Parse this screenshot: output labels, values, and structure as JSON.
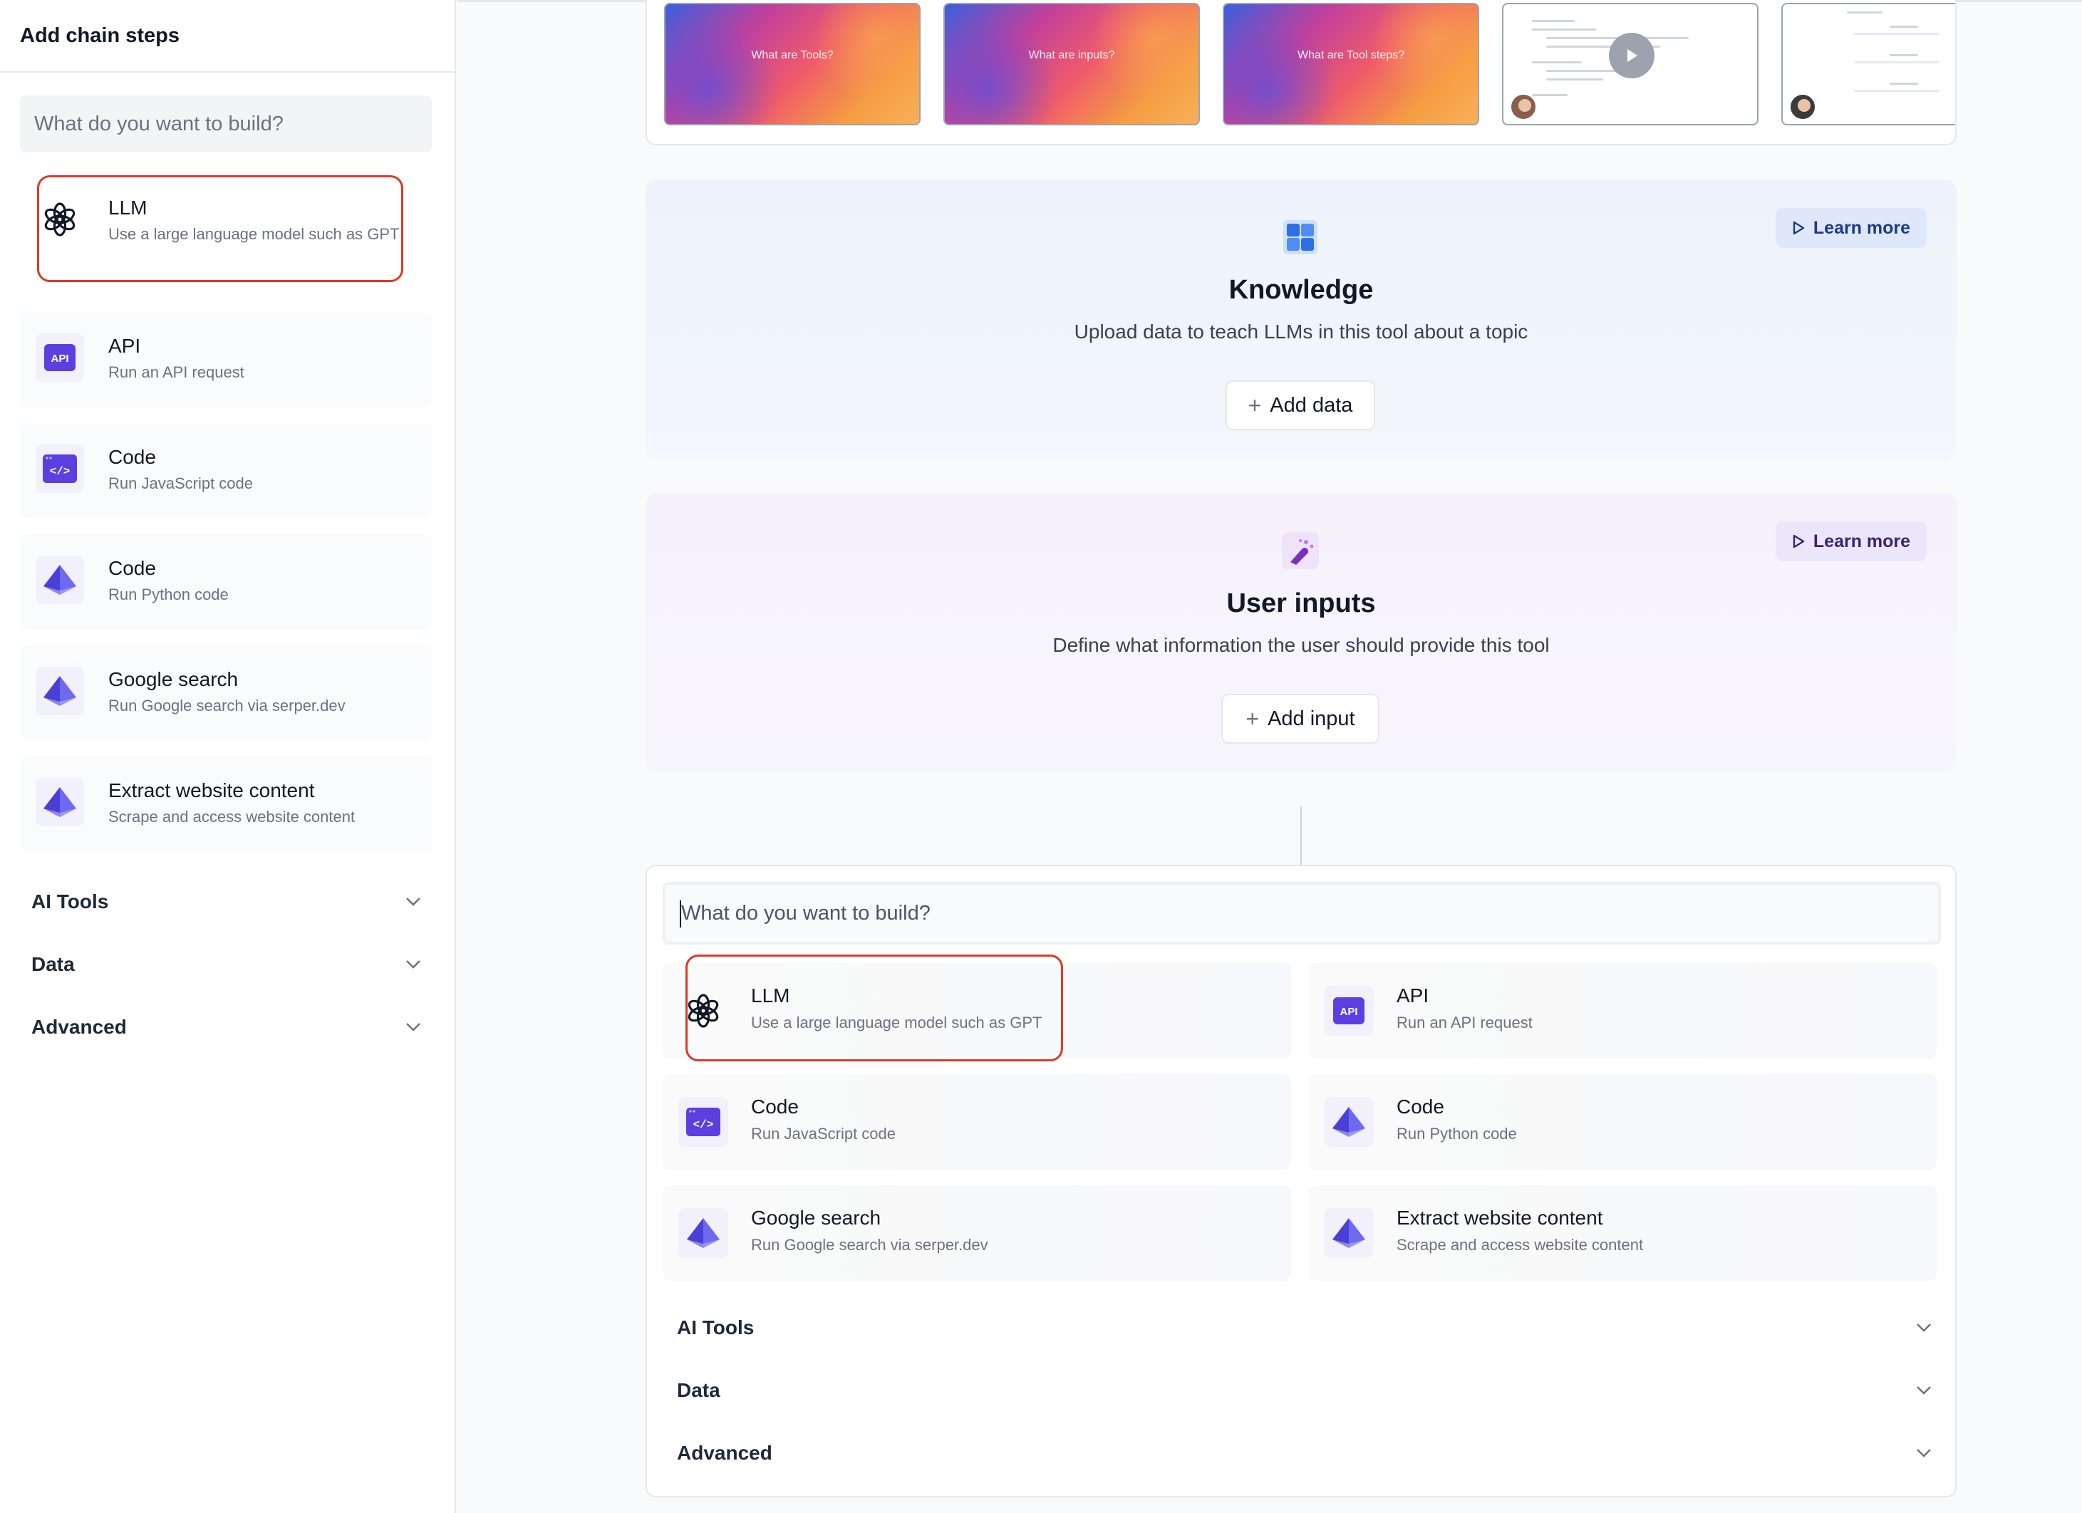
{
  "sidebar": {
    "title": "Add chain steps",
    "search_placeholder": "What do you want to build?",
    "items": [
      {
        "title": "LLM",
        "description": "Use a large language model such as GPT",
        "icon": "openai-icon"
      },
      {
        "title": "API",
        "description": "Run an API request",
        "icon": "api-icon"
      },
      {
        "title": "Code",
        "description": "Run JavaScript code",
        "icon": "code-icon"
      },
      {
        "title": "Code",
        "description": "Run Python code",
        "icon": "pyramid-icon"
      },
      {
        "title": "Google search",
        "description": "Run Google search via serper.dev",
        "icon": "pyramid-icon"
      },
      {
        "title": "Extract website content",
        "description": "Scrape and access website content",
        "icon": "pyramid-icon"
      }
    ],
    "sections": [
      "AI Tools",
      "Data",
      "Advanced"
    ]
  },
  "thumbnails": [
    {
      "label": "What are Tools?"
    },
    {
      "label": "What are inputs?"
    },
    {
      "label": "What are Tool steps?"
    }
  ],
  "knowledge": {
    "title": "Knowledge",
    "subtitle": "Upload data to teach LLMs in this tool about a topic",
    "button": "Add data",
    "learn_more": "Learn more"
  },
  "user_inputs": {
    "title": "User inputs",
    "subtitle": "Define what information the user should provide this tool",
    "button": "Add input",
    "learn_more": "Learn more"
  },
  "builder": {
    "search_placeholder": "What do you want to build?",
    "items": [
      {
        "title": "LLM",
        "description": "Use a large language model such as GPT",
        "icon": "openai-icon"
      },
      {
        "title": "API",
        "description": "Run an API request",
        "icon": "api-icon"
      },
      {
        "title": "Code",
        "description": "Run JavaScript code",
        "icon": "code-icon"
      },
      {
        "title": "Code",
        "description": "Run Python code",
        "icon": "pyramid-icon"
      },
      {
        "title": "Google search",
        "description": "Run Google search via serper.dev",
        "icon": "pyramid-icon"
      },
      {
        "title": "Extract website content",
        "description": "Scrape and access website content",
        "icon": "pyramid-icon"
      }
    ],
    "sections": [
      "AI Tools",
      "Data",
      "Advanced"
    ]
  },
  "colors": {
    "highlight_border": "#dc3a26",
    "icon_purple": "#5b3fe0",
    "knowledge_blue": "#2f6fe6"
  }
}
